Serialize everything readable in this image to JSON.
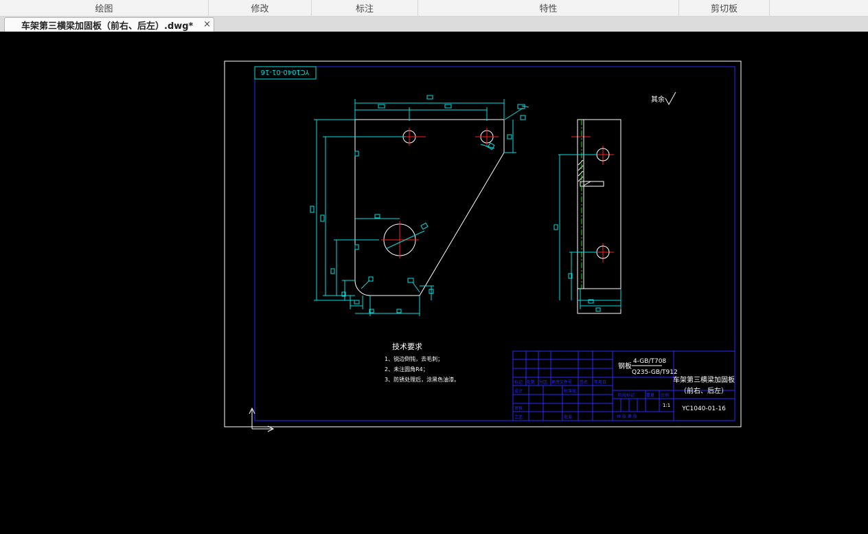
{
  "ribbon": {
    "groups": [
      {
        "label": "绘图",
        "name": "ribbon-group-draw"
      },
      {
        "label": "修改",
        "name": "ribbon-group-modify"
      },
      {
        "label": "标注",
        "name": "ribbon-group-annotate"
      },
      {
        "label": "特性",
        "name": "ribbon-group-properties"
      },
      {
        "label": "剪切板",
        "name": "ribbon-group-clipboard"
      }
    ]
  },
  "document_tab": {
    "title": "车架第三横梁加固板（前右、后左）.dwg*",
    "close_glyph": "×"
  },
  "drawing": {
    "drawing_code_top": "YC1040-01-16",
    "roughness_label": "其余",
    "notes_title": "技术要求",
    "notes": [
      "1、锐边倒钝，去毛刺；",
      "2、未注圆角R4；",
      "3、防锈处理后，涂黑色油漆。"
    ],
    "title_block": {
      "material_label": "钢板",
      "material_spec_top": "4-GB/T708",
      "material_spec_bottom": "Q235-GB/T912",
      "part_name_line1": "车架第三横梁加固板",
      "part_name_line2": "（前右、后左）",
      "drawing_code": "YC1040-01-16",
      "scale": "1:1",
      "header_labels": [
        "标记",
        "处数",
        "分区",
        "更改文件号",
        "签名",
        "年月日"
      ],
      "designer_label": "设计",
      "standardize_label": "标准化",
      "review_label": "审核",
      "process_label": "工艺",
      "approve_label": "批准",
      "stage_label": "阶段标记",
      "weight_label": "重量",
      "scale_label": "比例",
      "sheet_text": "共 张 第 张"
    }
  }
}
